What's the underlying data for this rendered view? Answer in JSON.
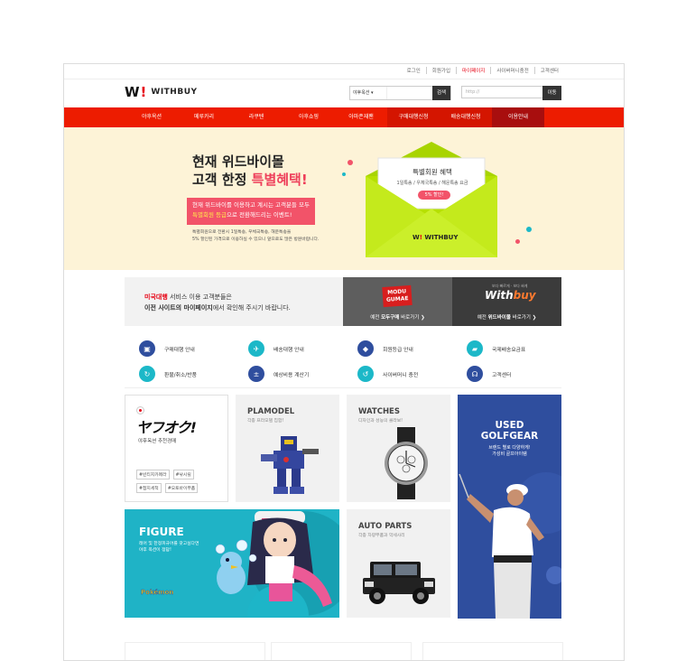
{
  "util_links": [
    {
      "label": "로그인",
      "highlight": false
    },
    {
      "label": "회원가입",
      "highlight": false
    },
    {
      "label": "마이페이지",
      "highlight": true
    },
    {
      "label": "사이버머니충전",
      "highlight": false
    },
    {
      "label": "고객센터",
      "highlight": false
    }
  ],
  "logo": {
    "mark": "W",
    "exclaim": "!",
    "text": "WITHBUY"
  },
  "search": {
    "select": "야후옥션 ▾",
    "button": "검색"
  },
  "url_box": {
    "placeholder": "http://",
    "button": "이동"
  },
  "nav": [
    "야후옥션",
    "메루카리",
    "라쿠텐",
    "아후쇼핑",
    "아마존재팬",
    "구매대행신청",
    "배송대행신청",
    "이용안내"
  ],
  "hero": {
    "line1": "현재 위드바이몰",
    "line2_a": "고객 한정 ",
    "line2_b": "특별혜택!",
    "pink_1": "현재 위드바이를 이용하고 계시는 고객분들 모두",
    "pink_2a": "특별회원 등급",
    "pink_2b": "으로 전환해드리는 이벤트!",
    "note_1": "특별회원으로 전환시 1일특송, 우체국특송, 해운특송을",
    "note_2": "5% 할인된 가격으로 이용하실 수 있으니 앞으로도 많은 방문바랍니다.",
    "offer_title": "특별회원 혜택",
    "offer_sub": "1일특송 / 우체국특송 / 해운특송 요금",
    "offer_badge": "5% 할인!",
    "envelope_logo": "WITHBUY"
  },
  "notice": {
    "red": "미국대행",
    "l1": " 서비스 이용 고객분들은",
    "l2_bold": "이전 사이트의 마이페이지",
    "l2": "에서 확인해 주시기 바랍니다."
  },
  "partner_modu": {
    "logo": "MODU GUMAE",
    "cap_pre": "예전 ",
    "cap_b": "모두구매",
    "cap_post": " 바로가기 ❯"
  },
  "partner_wb": {
    "tag": "보다 빠르게 · 보다 싸게",
    "logo_a": "With",
    "logo_b": "buy",
    "cap_pre": "예전 ",
    "cap_b": "위드바이몰",
    "cap_post": " 바로가기 ❯"
  },
  "quick": [
    {
      "label": "구매대행 안내",
      "icon": "bag-icon",
      "glyph": "▣",
      "color": "navy"
    },
    {
      "label": "배송대행 안내",
      "icon": "plane-icon",
      "glyph": "✈",
      "color": "teal"
    },
    {
      "label": "회원등급 안내",
      "icon": "diamond-icon",
      "glyph": "◆",
      "color": "navy"
    },
    {
      "label": "국제배송요금표",
      "icon": "truck-icon",
      "glyph": "▰",
      "color": "teal"
    },
    {
      "label": "환불/취소/반품",
      "icon": "refund-icon",
      "glyph": "↻",
      "color": "teal"
    },
    {
      "label": "예상비용 계산기",
      "icon": "calculator-icon",
      "glyph": "±",
      "color": "navy"
    },
    {
      "label": "사이버머니 충전",
      "icon": "coin-icon",
      "glyph": "↺",
      "color": "teal"
    },
    {
      "label": "고객센터",
      "icon": "headset-icon",
      "glyph": "☊",
      "color": "navy"
    }
  ],
  "cards": {
    "yahu_logo": "ヤフオク!",
    "yahu_sub": "야후옥션 추천경매",
    "yahu_tags": [
      "#빈티지카메라",
      "#낚시릴",
      "#접지세척",
      "#오토바이부품"
    ],
    "plamodel_title": "PLAMODEL",
    "plamodel_sub": "각종 프라모델 집합!",
    "watches_title": "WATCHES",
    "watches_sub": "디자인과 성능의 콜라보!",
    "golf_t1": "USED",
    "golf_t2": "GOLFGEAR",
    "golf_s1": "브랜드 별로 다양하게!",
    "golf_s2": "가성비 골프아이템",
    "figure_title": "FIGURE",
    "figure_s1": "레어 및 한정피규어를 갖고싶다면",
    "figure_s2": "야후 옥션이 정답!",
    "figure_pokemon": "Pokémon",
    "auto_title": "AUTO PARTS",
    "auto_sub": "각종 차량부품과 악세사리"
  }
}
